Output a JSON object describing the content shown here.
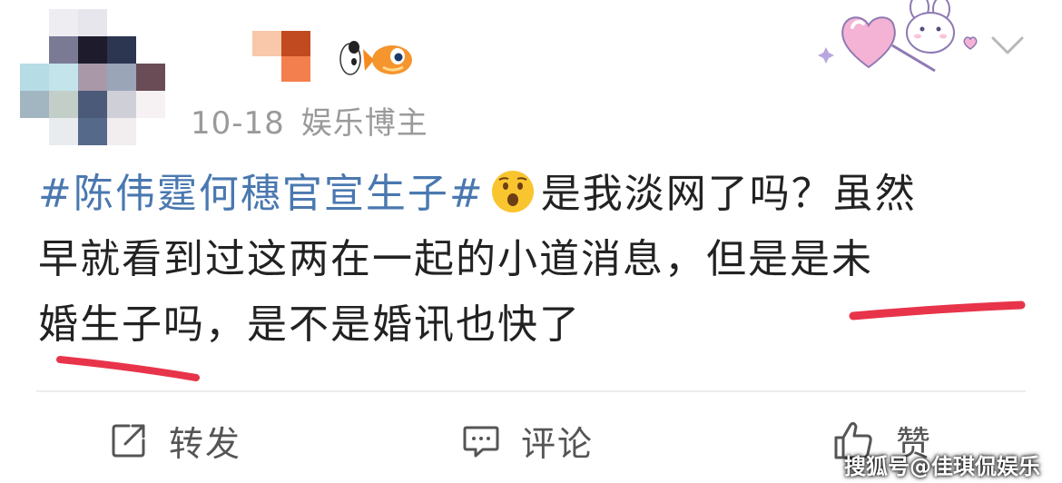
{
  "post": {
    "date": "10-18",
    "author_role": "娱乐博主",
    "topic": "#陈伟霆何穗官宣生子#",
    "emoji": "frowning-face-emoji",
    "line1_rest": "是我淡网了吗？虽然",
    "line2": "早就看到过这两在一起的小道消息，但是是未",
    "line3": "婚生子吗，是不是婚讯也快了"
  },
  "actions": {
    "repost_label": "转发",
    "comment_label": "评论",
    "like_label": "赞"
  },
  "watermark": "搜狐号@佳琪侃娱乐",
  "colors": {
    "topic": "#4a78b0",
    "text": "#222222",
    "meta": "#9a9a9a",
    "underline": "#e8344a"
  }
}
